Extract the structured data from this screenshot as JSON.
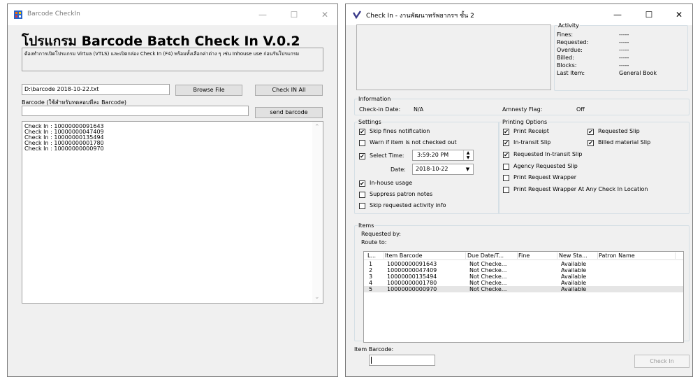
{
  "left_window": {
    "title": "Barcode CheckIn",
    "heading": "โปรแกรม Barcode Batch Check In  V.0.2",
    "note": "ต้องทำการเปิดโปรแกรม Virtua (VTLS) และเปิดกล่อง Check In (F4) พร้อมทั้งเลือกค่าต่าง ๆ เช่น Inhouse use ก่อนรันโปรแกรม",
    "file_path": "D:\\barcode 2018-10-22.txt",
    "browse_label": "Browse File",
    "checkin_all_label": "Check IN All",
    "barcode_field_label": "Barcode (ใช้สำหรับทดสอบทีละ Barcode)",
    "barcode_value": "",
    "send_label": "send barcode",
    "log": [
      "Check In : 10000000091643",
      "Check In : 10000000047409",
      "Check In : 10000000135494",
      "Check In : 10000000001780",
      "Check In : 10000000000970"
    ]
  },
  "right_window": {
    "title": "Check In - งานพัฒนาทรัพยากรฯ ชั้น 2",
    "activity": {
      "legend": "Activity",
      "rows": [
        {
          "label": "Fines:",
          "value": "-----"
        },
        {
          "label": "Requested:",
          "value": "-----"
        },
        {
          "label": "Overdue:",
          "value": "-----"
        },
        {
          "label": "Billed:",
          "value": "-----"
        },
        {
          "label": "Blocks:",
          "value": "-----"
        },
        {
          "label": "Last Item:",
          "value": "General Book"
        }
      ]
    },
    "information": {
      "legend": "Information",
      "checkin_date_label": "Check-in Date:",
      "checkin_date_value": "N/A",
      "amnesty_label": "Amnesty Flag:",
      "amnesty_value": "Off"
    },
    "settings": {
      "legend": "Settings",
      "skip_fines": {
        "label": "Skip fines notification",
        "checked": true
      },
      "warn_not_out": {
        "label": "Warn if item is not checked out",
        "checked": false
      },
      "select_time": {
        "label": "Select Time:",
        "checked": true
      },
      "time_value": "3:59:20 PM",
      "date_label": "Date:",
      "date_value": "2018-10-22",
      "inhouse": {
        "label": "In-house usage",
        "checked": true
      },
      "suppress_notes": {
        "label": "Suppress patron notes",
        "checked": false
      },
      "skip_requested": {
        "label": "Skip requested activity info",
        "checked": false
      }
    },
    "printing": {
      "legend": "Printing Options",
      "print_receipt": {
        "label": "Print Receipt",
        "checked": true
      },
      "requested_slip": {
        "label": "Requested Slip",
        "checked": true
      },
      "in_transit_slip": {
        "label": "In-transit Slip",
        "checked": true
      },
      "billed_material_slip": {
        "label": "Billed material Slip",
        "checked": true
      },
      "requested_in_transit_slip": {
        "label": "Requested In-transit Slip",
        "checked": true
      },
      "agency_requested_slip": {
        "label": "Agency Requested Slip",
        "checked": false
      },
      "print_request_wrapper": {
        "label": "Print Request Wrapper",
        "checked": false
      },
      "wrapper_any_location": {
        "label": "Print Request Wrapper At Any Check In Location",
        "checked": false
      }
    },
    "items": {
      "legend": "Items",
      "requested_by": "Requested by:",
      "route_to": "Route to:",
      "columns": [
        "L...",
        "Item Barcode",
        "Due Date/T...",
        "Fine",
        "New Sta...",
        "Patron Name"
      ],
      "rows": [
        [
          "1",
          "10000000091643",
          "Not Checke...",
          "",
          "Available",
          ""
        ],
        [
          "2",
          "10000000047409",
          "Not Checke...",
          "",
          "Available",
          ""
        ],
        [
          "3",
          "10000000135494",
          "Not Checke...",
          "",
          "Available",
          ""
        ],
        [
          "4",
          "10000000001780",
          "Not Checke...",
          "",
          "Available",
          ""
        ],
        [
          "5",
          "10000000000970",
          "Not Checke...",
          "",
          "Available",
          ""
        ]
      ],
      "selected_index": 4
    },
    "item_barcode_label": "Item Barcode:",
    "item_barcode_value": "",
    "checkin_button_label": "Check In"
  },
  "colors": {
    "window_bg": "#f0f0f0",
    "selection": "#e5e5e5",
    "check_mark": "#000000"
  }
}
